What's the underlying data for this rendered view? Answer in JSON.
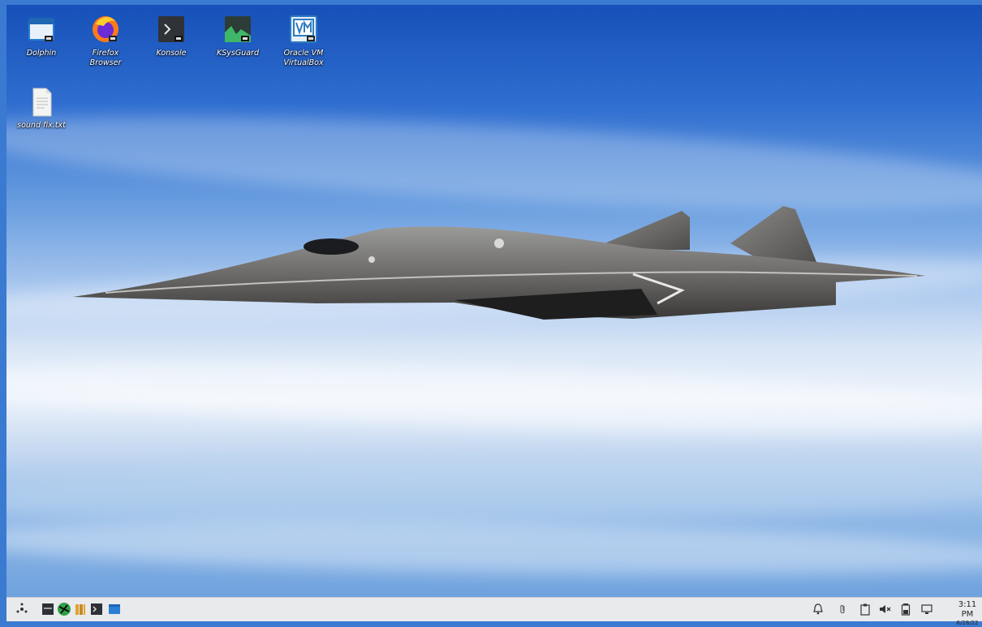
{
  "desktop": {
    "icons": [
      {
        "label": "Dolphin",
        "icon": "folder-icon"
      },
      {
        "label": "Firefox\nBrowser",
        "icon": "firefox-icon"
      },
      {
        "label": "Konsole",
        "icon": "terminal-icon"
      },
      {
        "label": "KSysGuard",
        "icon": "system-monitor-icon"
      },
      {
        "label": "Oracle VM\nVirtualBox",
        "icon": "virtualbox-icon"
      },
      {
        "label": "sound fix.txt",
        "icon": "text-file-icon"
      }
    ],
    "wallpaper": "stealth-jet-above-clouds"
  },
  "taskbar": {
    "launchers": [
      {
        "name": "application-launcher",
        "icon": "kde-launcher-icon"
      },
      {
        "name": "show-desktop",
        "icon": "show-desktop-icon"
      },
      {
        "name": "browser",
        "icon": "globe-icon"
      },
      {
        "name": "files",
        "icon": "library-icon"
      },
      {
        "name": "terminal",
        "icon": "terminal-icon"
      },
      {
        "name": "file-manager",
        "icon": "folder-icon"
      }
    ],
    "tray": [
      {
        "name": "notifications",
        "icon": "bell-icon"
      },
      {
        "name": "attachments",
        "icon": "paperclip-icon"
      },
      {
        "name": "clipboard",
        "icon": "clipboard-icon"
      },
      {
        "name": "volume",
        "icon": "speaker-muted-icon"
      },
      {
        "name": "battery",
        "icon": "battery-icon"
      },
      {
        "name": "network",
        "icon": "monitor-icon"
      }
    ],
    "clock": {
      "time": "3:11 PM",
      "date": "6/28/22"
    }
  },
  "colors": {
    "sky_top": "#1650b8",
    "taskbar_bg": "#e9eaec",
    "label_text": "#ffffff"
  }
}
